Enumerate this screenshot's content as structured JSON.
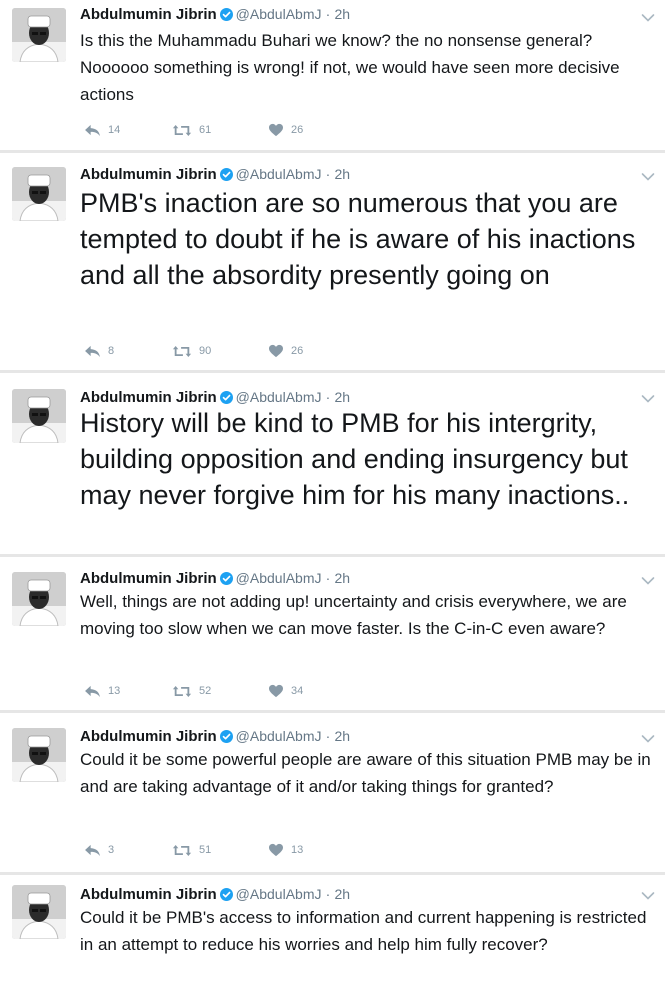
{
  "author": {
    "name": "Abdulmumin Jibrin",
    "handle": "@AbdulAbmJ",
    "separator": "·",
    "time": "2h"
  },
  "icons": {
    "verified": "verified-badge-icon",
    "reply": "reply-icon",
    "retweet": "retweet-icon",
    "like": "heart-icon",
    "menu": "chevron-down-icon"
  },
  "colors": {
    "verified": "#1da1f2",
    "action": "#8899a6",
    "meta": "#657786"
  },
  "tweets": [
    {
      "text": "Is this the Muhammadu Buhari we know? the no nonsense general? Noooooo something is wrong!  if not, we would have seen more decisive actions",
      "replies": "14",
      "retweets": "61",
      "likes": "26"
    },
    {
      "text": "PMB's inaction are so numerous that you are tempted to doubt if he is aware of his inactions and all the absordity presently going on",
      "replies": "8",
      "retweets": "90",
      "likes": "26"
    },
    {
      "text": "History will be kind to PMB for his intergrity, building opposition and ending insurgency but may never forgive him for his many inactions.."
    },
    {
      "text": "Well, things are not adding up! uncertainty and crisis everywhere, we are moving too slow when we can move faster. Is the C-in-C even aware?",
      "replies": "13",
      "retweets": "52",
      "likes": "34"
    },
    {
      "text": "Could it be some powerful people are aware of this situation PMB may be in and are taking advantage of it and/or taking things for granted?",
      "replies": "3",
      "retweets": "51",
      "likes": "13"
    },
    {
      "text": "Could it be PMB's access to information and current happening is restricted in an attempt to reduce his worries and help him fully recover?"
    }
  ]
}
